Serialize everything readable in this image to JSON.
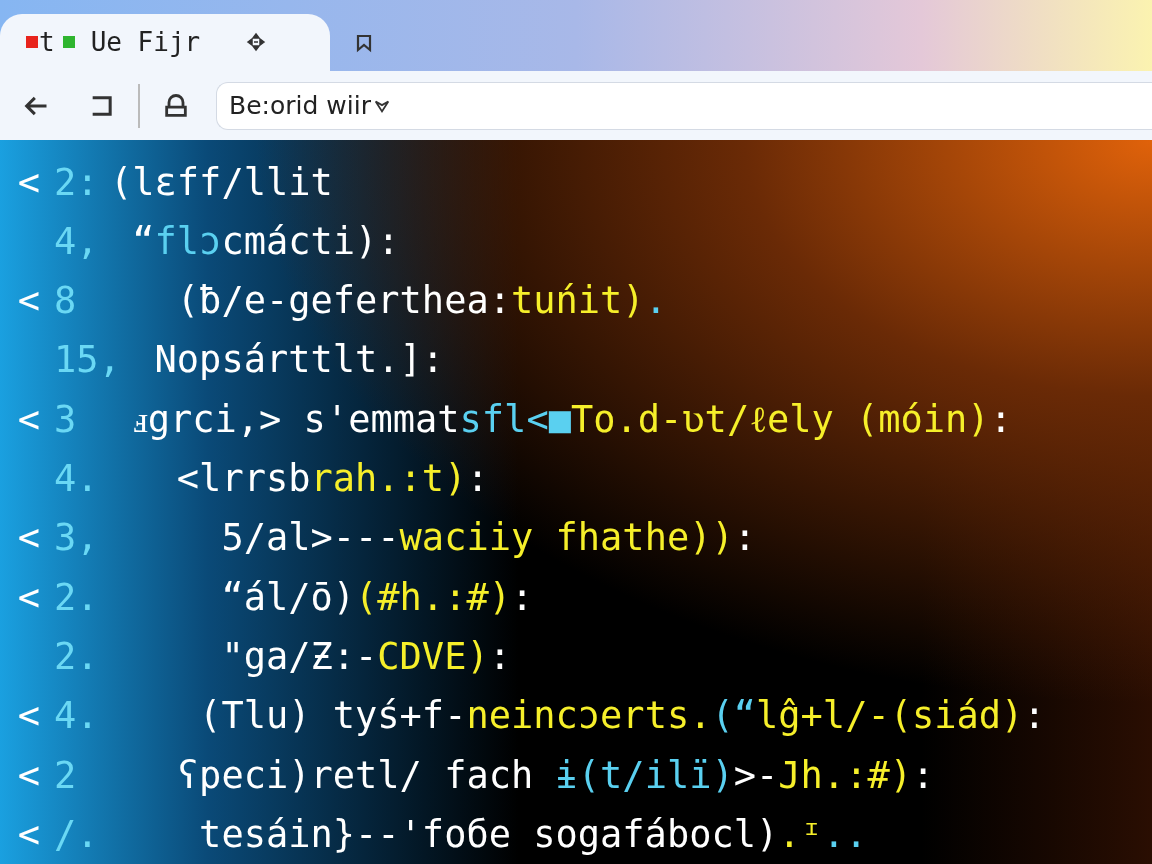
{
  "tabs": [
    {
      "prefix": "t",
      "title": "Ue Fijr",
      "selected": true
    }
  ],
  "address_bar": {
    "value": "Be:orid wiir"
  },
  "code_lines": [
    {
      "marker": "<",
      "number": "2:",
      "segments": [
        {
          "kind": "plain",
          "text": "(lɛff/llit"
        }
      ]
    },
    {
      "number": "4,",
      "segments": [
        {
          "kind": "plain",
          "text": " “"
        },
        {
          "kind": "name",
          "text": "flɔ"
        },
        {
          "kind": "plain",
          "text": "cmácti):"
        }
      ]
    },
    {
      "marker": "<",
      "number": "8",
      "segments": [
        {
          "kind": "plain",
          "text": "   (ƀ/e-gefertheа:"
        },
        {
          "kind": "string",
          "text": "tuńit)"
        },
        {
          "kind": "name",
          "text": "."
        }
      ]
    },
    {
      "number": "15,",
      "segments": [
        {
          "kind": "plain",
          "text": "  Nopsárttlt.]:"
        }
      ]
    },
    {
      "marker": "<",
      "number": "3",
      "segments": [
        {
          "kind": "plain",
          "text": " ⅎgrci,> s'emmat"
        },
        {
          "kind": "name",
          "text": "sfl<■"
        },
        {
          "kind": "string",
          "text": "To.d-ʋt/ℓely (móin)"
        },
        {
          "kind": "plain",
          "text": ":"
        }
      ]
    },
    {
      "number": "4.",
      "segments": [
        {
          "kind": "plain",
          "text": "   <lrrsb"
        },
        {
          "kind": "string",
          "text": "rah.:t)"
        },
        {
          "kind": "plain",
          "text": ":"
        }
      ]
    },
    {
      "marker": "<",
      "number": "3,",
      "segments": [
        {
          "kind": "plain",
          "text": "     5/al>---"
        },
        {
          "kind": "string",
          "text": "waciiy fhathe))"
        },
        {
          "kind": "plain",
          "text": ":"
        }
      ]
    },
    {
      "marker": "<",
      "number": "2.",
      "segments": [
        {
          "kind": "plain",
          "text": "     “ál/ō)"
        },
        {
          "kind": "string",
          "text": "(#h.:#)"
        },
        {
          "kind": "plain",
          "text": ":"
        }
      ]
    },
    {
      "number": "2.",
      "segments": [
        {
          "kind": "plain",
          "text": "     \"ga/Ƶ:-"
        },
        {
          "kind": "string",
          "text": "CDVE)"
        },
        {
          "kind": "plain",
          "text": ":"
        }
      ]
    },
    {
      "marker": "<",
      "number": "4.",
      "segments": [
        {
          "kind": "plain",
          "text": "    (Tlu) tyś+f-"
        },
        {
          "kind": "string",
          "text": "neincɔerts."
        },
        {
          "kind": "name",
          "text": "(“"
        },
        {
          "kind": "string",
          "text": "lĝ+l/-(siád)"
        },
        {
          "kind": "plain",
          "text": ":"
        }
      ]
    },
    {
      "marker": "<",
      "number": "2",
      "segments": [
        {
          "kind": "plain",
          "text": "   ʕpeci)retl/ fach "
        },
        {
          "kind": "name",
          "text": "ɨ(t/ilï)"
        },
        {
          "kind": "plain",
          "text": ">-"
        },
        {
          "kind": "string",
          "text": "Jh.:#)"
        },
        {
          "kind": "plain",
          "text": ":"
        }
      ]
    },
    {
      "marker": "<",
      "number": "/.",
      "segments": [
        {
          "kind": "plain",
          "text": "    tesáin}--'foбe sogafábocl)"
        },
        {
          "kind": "string",
          "text": ".ᶦ"
        },
        {
          "kind": "name",
          "text": ".."
        }
      ]
    }
  ]
}
